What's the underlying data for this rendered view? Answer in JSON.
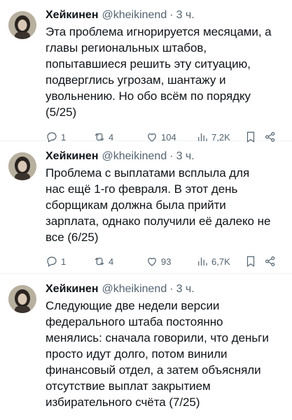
{
  "tweets": [
    {
      "name": "Хейкинен",
      "handle": "@kheikinend",
      "dot": "·",
      "time": "3 ч.",
      "lines": [
        "Эта проблема игнорируется месяцами, а",
        "главы региональных штабов,",
        "попытавшиеся решить эту ситуацию,",
        "подверглись угрозам, шантажу и",
        "увольнению. Но обо всём по порядку",
        "(5/25)"
      ],
      "replies": "1",
      "retweets": "4",
      "likes": "104",
      "views": "7,2K"
    },
    {
      "name": "Хейкинен",
      "handle": "@kheikinend",
      "dot": "·",
      "time": "3 ч.",
      "lines": [
        "Проблема с выплатами всплыла для",
        "нас ещё 1-го февраля. В этот день",
        "сборщикам должна была прийти",
        "зарплата, однако получили её далеко не",
        "все (6/25)"
      ],
      "replies": "1",
      "retweets": "4",
      "likes": "93",
      "views": "6,7K"
    },
    {
      "name": "Хейкинен",
      "handle": "@kheikinend",
      "dot": "·",
      "time": "3 ч.",
      "lines": [
        "Следующие две недели версии",
        "федерального штаба постоянно",
        "менялись: сначала говорили, что деньги",
        "просто идут долго, потом винили",
        "финансовый отдел, а затем объясняли",
        "отсутствие выплат закрытием",
        "избирательного счёта (7/25)"
      ]
    }
  ],
  "icons": {
    "reply": "reply-icon",
    "retweet": "retweet-icon",
    "like": "heart-icon",
    "views": "views-icon",
    "bookmark": "bookmark-icon",
    "share": "share-icon"
  },
  "colors": {
    "text": "#0f1419",
    "secondary": "#536471",
    "divider": "#eff3f4"
  }
}
